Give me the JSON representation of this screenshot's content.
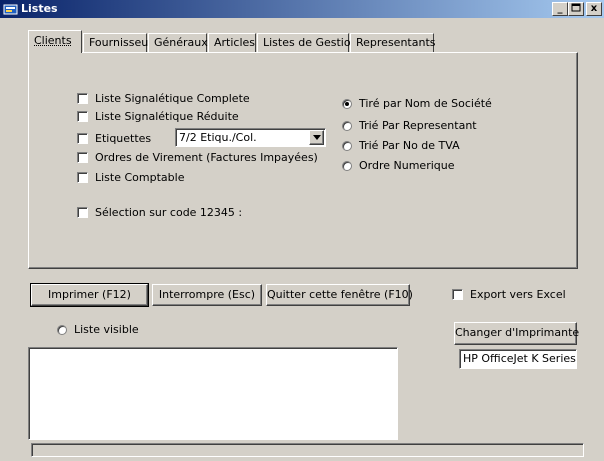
{
  "window": {
    "title": "Listes",
    "minimize": "_",
    "maximize": "□",
    "close": "x"
  },
  "tabs": [
    {
      "label": "Clients",
      "mnemonic_pos": 0
    },
    {
      "label": "Fournisseurs"
    },
    {
      "label": "Généraux"
    },
    {
      "label": "Articles"
    },
    {
      "label": "Listes de Gestion"
    },
    {
      "label": "Representants"
    }
  ],
  "options": {
    "liste_complete": "Liste Signalétique Complete",
    "liste_reduite": "Liste Signalétique Réduite",
    "etiquettes": "Etiquettes",
    "etiquettes_combo": "7/2 Etiqu./Col.",
    "ordres_virement": "Ordres de Virement (Factures Impayées)",
    "liste_comptable": "Liste Comptable",
    "selection_code": "Sélection sur code 12345 :"
  },
  "sort": [
    {
      "label": "Tiré par Nom de Société",
      "selected": true
    },
    {
      "label": "Trié Par Representant",
      "selected": false
    },
    {
      "label": "Trié Par No de TVA",
      "selected": false
    },
    {
      "label": "Ordre Numerique",
      "selected": false
    }
  ],
  "buttons": {
    "imprimer": "Imprimer    (F12)",
    "interrompre": "Interrompre  (Esc)",
    "quitter": "Quitter cette fenêtre  (F10)",
    "changer_imprimante": "Changer d'Imprimante"
  },
  "export_excel": "Export vers Excel",
  "liste_visible": "Liste visible",
  "printer_name": "HP OfficeJet K Series"
}
